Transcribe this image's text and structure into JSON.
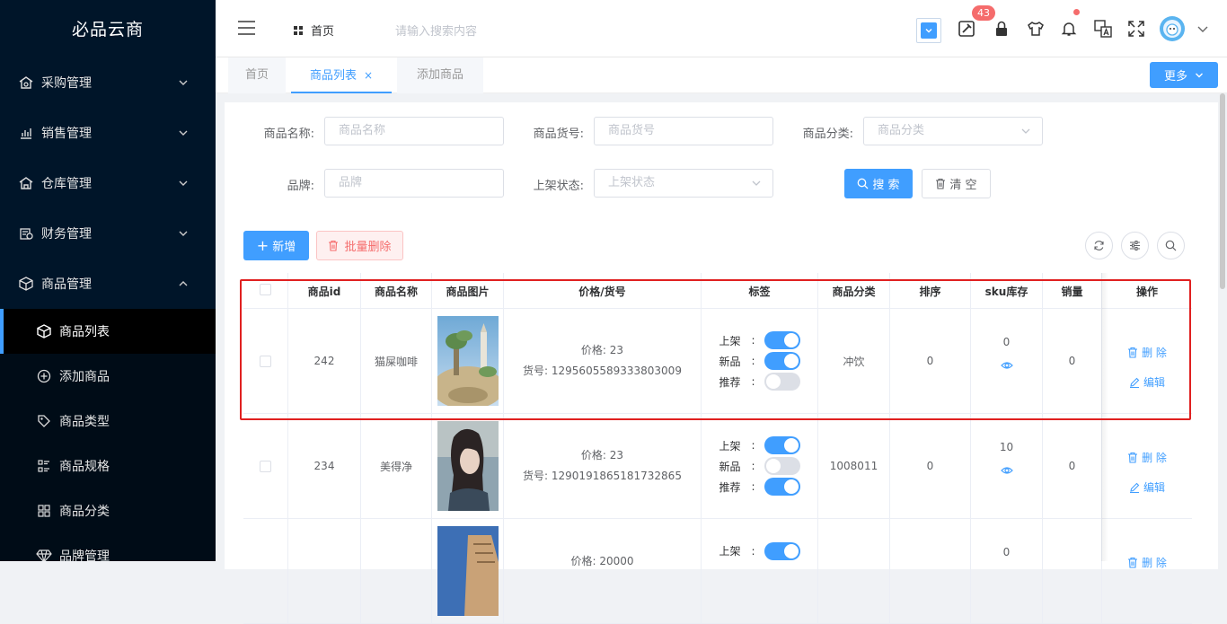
{
  "sidebar": {
    "logo": "必品云商",
    "menus": [
      {
        "label": "采购管理",
        "icon": "purchase-icon"
      },
      {
        "label": "销售管理",
        "icon": "sales-chart-icon"
      },
      {
        "label": "仓库管理",
        "icon": "warehouse-icon"
      },
      {
        "label": "财务管理",
        "icon": "finance-icon"
      },
      {
        "label": "商品管理",
        "icon": "product-box-icon"
      }
    ],
    "submenu": [
      {
        "label": "商品列表",
        "icon": "product-box-icon",
        "active": true
      },
      {
        "label": "添加商品",
        "icon": "plus-circle-icon"
      },
      {
        "label": "商品类型",
        "icon": "tag-icon"
      },
      {
        "label": "商品规格",
        "icon": "spec-list-icon"
      },
      {
        "label": "商品分类",
        "icon": "grid-icon"
      },
      {
        "label": "品牌管理",
        "icon": "diamond-icon"
      }
    ]
  },
  "header": {
    "home": "首页",
    "search_placeholder": "请输入搜索内容",
    "badge_count": "43"
  },
  "tabs": [
    {
      "label": "首页"
    },
    {
      "label": "商品列表",
      "active": true
    },
    {
      "label": "添加商品"
    }
  ],
  "more_button": "更多",
  "filters": {
    "name_label": "商品名称:",
    "name_placeholder": "商品名称",
    "sn_label": "商品货号:",
    "sn_placeholder": "商品货号",
    "cat_label": "商品分类:",
    "cat_placeholder": "商品分类",
    "brand_label": "品牌:",
    "brand_placeholder": "品牌",
    "status_label": "上架状态:",
    "status_placeholder": "上架状态",
    "search_btn": "搜 索",
    "clear_btn": "清 空"
  },
  "actions": {
    "add": "新增",
    "batch_delete": "批量删除"
  },
  "table": {
    "columns": [
      "商品id",
      "商品名称",
      "商品图片",
      "价格/货号",
      "标签",
      "商品分类",
      "排序",
      "sku库存",
      "销量",
      "操作"
    ],
    "tag_labels": {
      "on_shelf": "上架",
      "new": "新品",
      "recommend": "推荐",
      "colon": ":"
    },
    "price_prefix": "价格:",
    "sn_prefix": "货号:",
    "delete_label": "删 除",
    "edit_label": "编辑",
    "rows": [
      {
        "id": "242",
        "name": "猫屎咖啡",
        "price": "价格: 23",
        "sn": "货号: 1295605589333803009",
        "publish": true,
        "new": true,
        "recommend": false,
        "category": "冲饮",
        "sort": "0",
        "sku": "0",
        "sales": "0"
      },
      {
        "id": "234",
        "name": "美得净",
        "price": "价格: 23",
        "sn": "货号: 1290191865181732865",
        "publish": true,
        "new": false,
        "recommend": true,
        "category": "1008011",
        "sort": "0",
        "sku": "10",
        "sales": "0"
      },
      {
        "id": "",
        "name": "",
        "price": "价格: 20000",
        "sn": "",
        "publish": true,
        "new": false,
        "recommend": false,
        "category": "",
        "sort": "",
        "sku": "0",
        "sales": ""
      }
    ]
  }
}
